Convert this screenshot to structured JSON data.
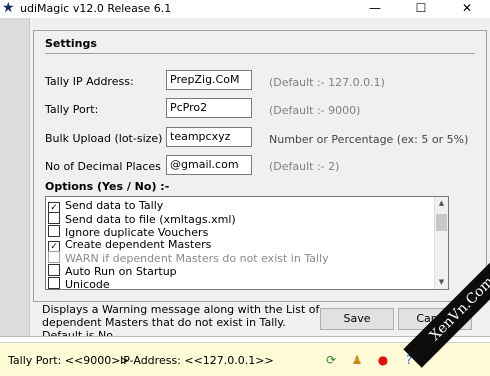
{
  "window": {
    "title": "udiMagic v12.0 Release 6.1",
    "controls": {
      "minimize": "—",
      "maximize": "☐",
      "close": "✕"
    }
  },
  "settings": {
    "heading": "Settings",
    "fields": [
      {
        "label": "Tally IP Address:",
        "value": "PrepZig.CoM",
        "hint": "(Default :-  127.0.0.1)"
      },
      {
        "label": "Tally Port:",
        "value": "PcPro2",
        "hint": "(Default :-  9000)"
      },
      {
        "label": "Bulk Upload (lot-size)",
        "value": "teampcxyz",
        "hint": "Number or Percentage (ex: 5 or  5%)"
      },
      {
        "label": "No of Decimal Places",
        "value": "@gmail.com",
        "hint": "(Default :-  2)"
      }
    ]
  },
  "options": {
    "heading": "Options (Yes / No) :-",
    "items": [
      {
        "label": "Send data to Tally",
        "checked": true,
        "enabled": true
      },
      {
        "label": "Send data to file (xmltags.xml)",
        "checked": false,
        "enabled": true
      },
      {
        "label": "Ignore duplicate Vouchers",
        "checked": false,
        "enabled": true
      },
      {
        "label": "Create dependent Masters",
        "checked": true,
        "enabled": true
      },
      {
        "label": "WARN if dependent Masters do not exist in Tally",
        "checked": false,
        "enabled": false
      },
      {
        "label": "Auto Run on Startup",
        "checked": false,
        "enabled": true
      },
      {
        "label": "Unicode",
        "checked": false,
        "enabled": true
      }
    ]
  },
  "description": "Displays a Warning message along with the List of dependent Masters that do not exist in Tally. Default is No.",
  "buttons": {
    "save": "Save",
    "cancel": "Cancel"
  },
  "statusbar": {
    "port": "Tally Port: <<9000>>",
    "ip": "IP-Address: <<127.0.0.1>>"
  },
  "watermark": "XenVn.Com"
}
